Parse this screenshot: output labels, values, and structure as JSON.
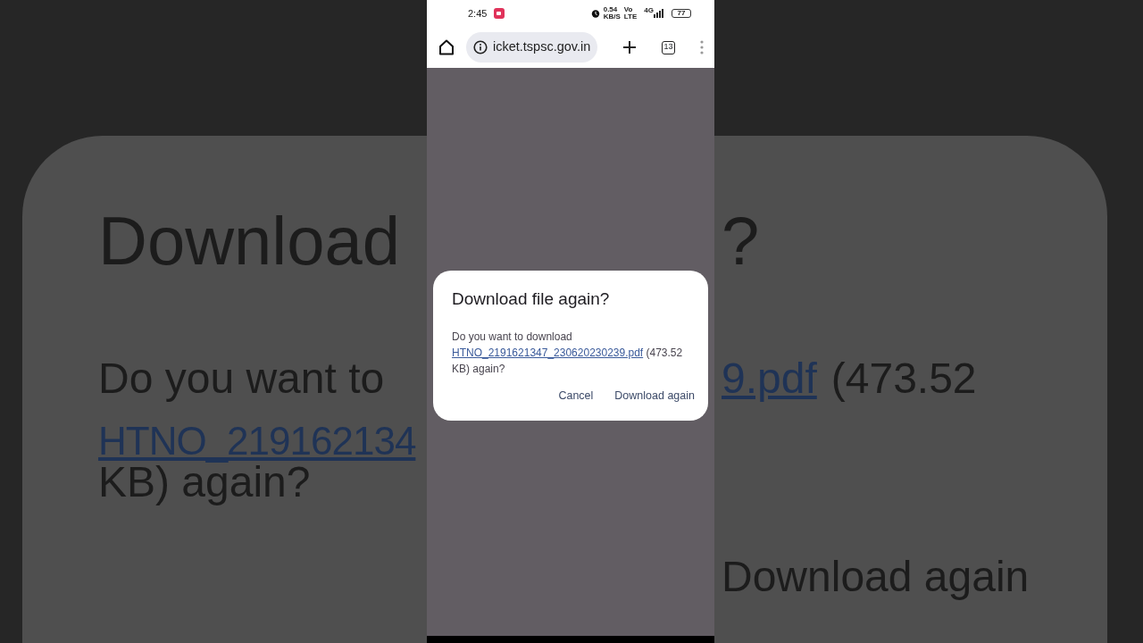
{
  "backdrop": {
    "left": [
      {
        "kind": "title",
        "text": "Download"
      },
      {
        "kind": "text",
        "text": "Do you want to"
      },
      {
        "kind": "link",
        "text": "HTNO_219162134"
      },
      {
        "kind": "text",
        "text": "KB) again?"
      }
    ],
    "right": [
      {
        "kind": "title",
        "text": "?"
      },
      {
        "kind": "mixed",
        "link": "9.pdf",
        "text": "(473.52"
      },
      {
        "kind": "action",
        "text": "Download again"
      }
    ]
  },
  "status_bar": {
    "time": "2:45",
    "speed": "0.54",
    "speed_unit": "KB/S",
    "volte_top": "Vo",
    "volte_bottom": "LTE",
    "network": "4G",
    "battery": "77"
  },
  "browser": {
    "url": "icket.tspsc.gov.in",
    "tab_count": "13"
  },
  "dialog": {
    "title": "Download file again?",
    "message_before": "Do you want to download",
    "file_link": "HTNO_2191621347_230620230239.pdf",
    "message_after": "(473.52 KB) again?",
    "buttons": [
      "Cancel",
      "Download again"
    ]
  }
}
